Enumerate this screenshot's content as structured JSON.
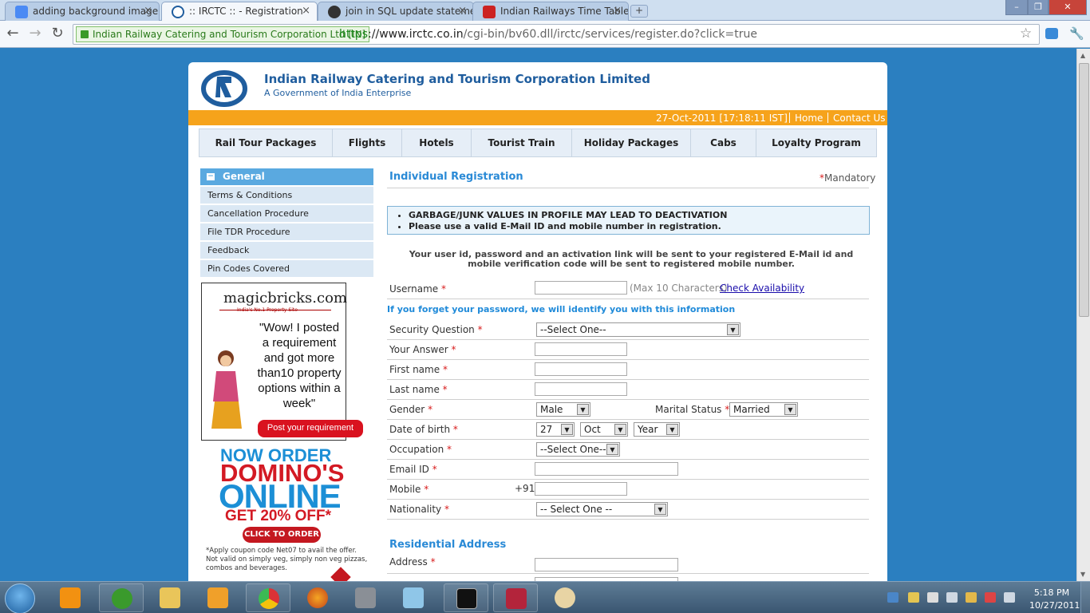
{
  "browser": {
    "tabs": [
      {
        "title": "adding background image i",
        "active": false
      },
      {
        "title": ":: IRCTC :: - Registration",
        "active": true
      },
      {
        "title": "join in SQL update statemer",
        "active": false
      },
      {
        "title": "Indian Railways Time Table",
        "active": false
      }
    ],
    "new_tab_label": "+",
    "ev_cert": "Indian Railway Catering and Tourism Corporation Ltd [IN]",
    "url_scheme": "https",
    "url_domain": "://www.irctc.co.in",
    "url_path": "/cgi-bin/bv60.dll/irctc/services/register.do?click=true"
  },
  "header": {
    "company": "Indian Railway Catering and Tourism Corporation Limited",
    "subtitle": "A Government of India Enterprise",
    "datetime": "27-Oct-2011 [17:18:11 IST]",
    "home": "Home",
    "contact": "Contact Us"
  },
  "menu": [
    "Rail Tour Packages",
    "Flights",
    "Hotels",
    "Tourist Train",
    "Holiday Packages",
    "Cabs",
    "Loyalty Program"
  ],
  "sidebar": {
    "heading": "General",
    "links": [
      "Terms & Conditions",
      "Cancellation Procedure",
      "File TDR Procedure",
      "Feedback",
      "Pin Codes Covered"
    ]
  },
  "ad_magicbricks": {
    "brand": "magicbricks.com",
    "tagline": "India's No.1 Property Site",
    "quote": "\"Wow! I posted a requirement and got more than10 property options within a week\"",
    "button": "Post your requirement"
  },
  "ad_dominos": {
    "line1": "NOW ORDER",
    "line2": "DOMINO'S",
    "line3": "ONLINE",
    "line4": "GET 20% OFF*",
    "button": "CLICK TO ORDER",
    "note": "*Apply coupon code Net07 to avail the offer. Not valid on simply veg, simply non veg pizzas, combos and beverages."
  },
  "form": {
    "title": "Individual Registration",
    "mandatory": "Mandatory",
    "warnings": [
      "GARBAGE/JUNK VALUES IN PROFILE MAY LEAD TO DEACTIVATION",
      "Please use a valid E-Mail ID and mobile number in registration."
    ],
    "info": "Your user id, password and an activation link will be sent to your registered E-Mail id and mobile verification code will be sent to registered mobile number.",
    "username_label": "Username",
    "username_hint": "(Max 10 Characters)",
    "check_availability": "Check Availability",
    "forget_note": "If you forget your password, we will identify you with this information",
    "security_question_label": "Security Question",
    "security_question_value": "--Select One--",
    "answer_label": "Your Answer",
    "first_name_label": "First name",
    "last_name_label": "Last name",
    "gender_label": "Gender",
    "gender_value": "Male",
    "marital_label": "Marital Status",
    "marital_value": "Married",
    "dob_label": "Date of birth",
    "dob_day": "27",
    "dob_month": "Oct",
    "dob_year": "Year",
    "occupation_label": "Occupation",
    "occupation_value": "--Select One--",
    "email_label": "Email ID",
    "mobile_label": "Mobile",
    "mobile_prefix": "+91",
    "nationality_label": "Nationality",
    "nationality_value": "-- Select One --",
    "residential_title": "Residential Address",
    "address_label": "Address"
  },
  "taskbar": {
    "time": "5:18 PM",
    "date": "10/27/2011"
  },
  "colors": {
    "page_bg": "#2b7fc0",
    "accent_orange": "#f6a31b",
    "heading_blue": "#2a8ad6",
    "required_red": "#d81b1b"
  }
}
